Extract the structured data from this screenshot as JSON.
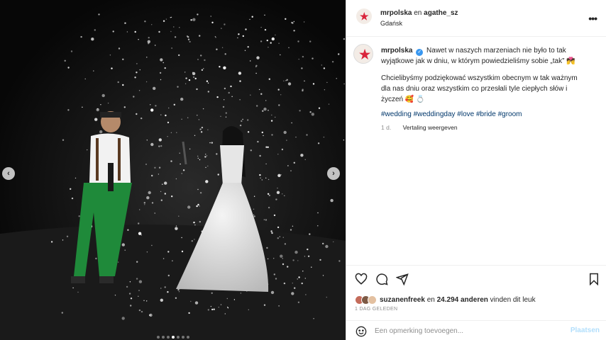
{
  "media": {
    "alt": "",
    "slide_count": 7,
    "active_slide": 4
  },
  "header": {
    "username": "mrpolska",
    "connector": "en",
    "collaborator": "agathe_sz",
    "location": "Gdańsk"
  },
  "caption": {
    "username": "mrpolska",
    "text1": "Nawet w naszych marzeniach nie było to tak wyjątkowe jak w dniu, w którym powiedzieliśmy sobie „tak” 💏",
    "text2": "Chcielibyśmy podziękować wszystkim obecnym w tak ważnym dla nas dniu oraz wszystkim co przesłali tyle ciepłych słów i życzeń 🥰 💍",
    "hashtags": "#wedding #weddingday #love #bride #groom",
    "age": "1 d.",
    "translate": "Vertaling weergeven"
  },
  "likes": {
    "user": "suzanenfreek",
    "en": "en",
    "count": "24.294 anderen",
    "suffix": "vinden dit leuk"
  },
  "date": "1 DAG GELEDEN",
  "comment": {
    "placeholder": "Een opmerking toevoegen...",
    "post_label": "Plaatsen"
  },
  "icons": {
    "more": "more-horizontal-icon",
    "like": "heart-icon",
    "comment": "comment-bubble-icon",
    "share": "paper-plane-icon",
    "save": "bookmark-icon",
    "emoji": "smiley-icon"
  },
  "colors": {
    "verified": "#3897f0",
    "hashtag": "#00376b",
    "post_button_disabled": "#b2dffc",
    "brand_star": "#d9243b"
  }
}
